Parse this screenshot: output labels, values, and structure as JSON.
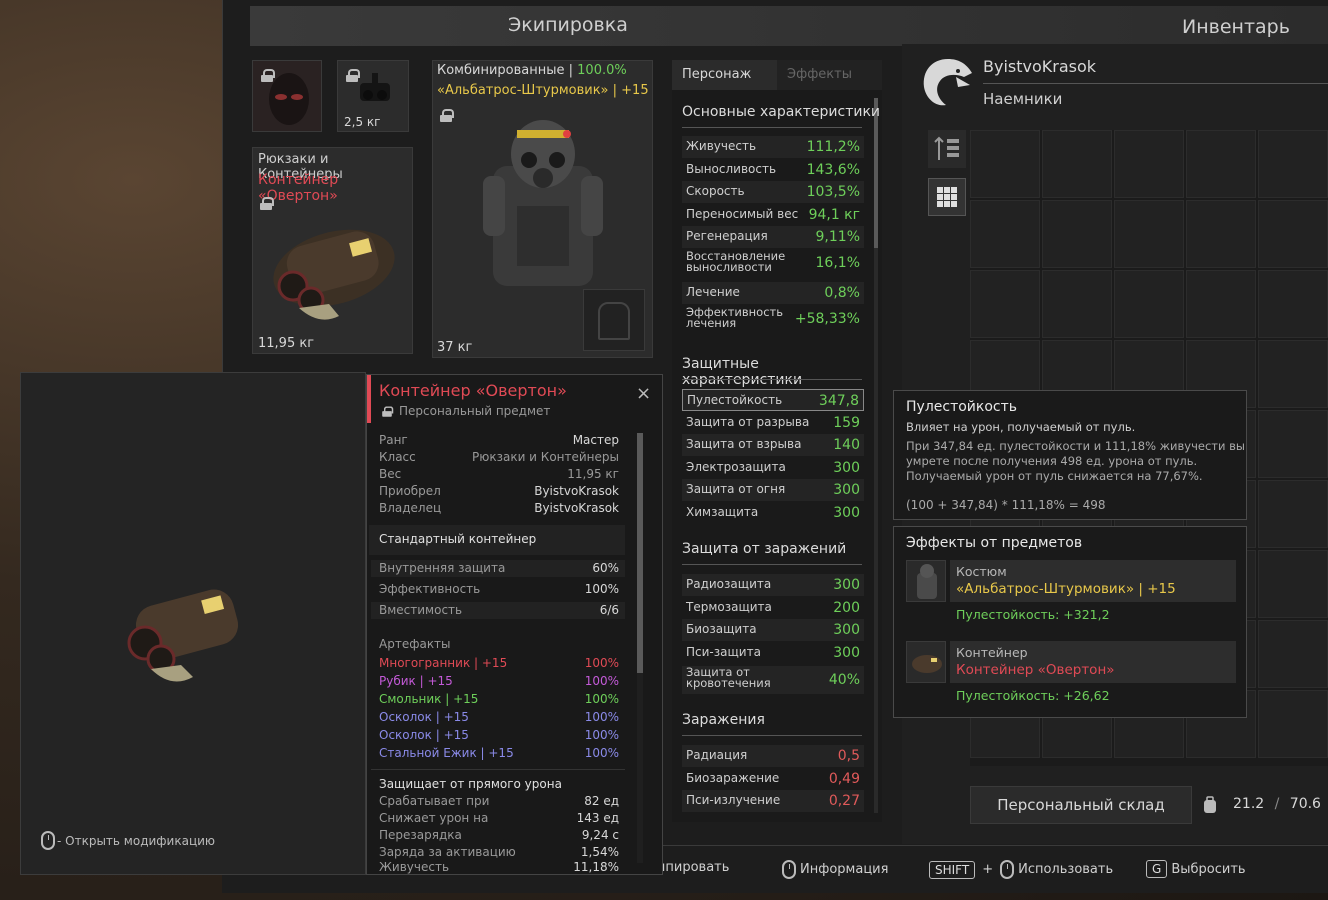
{
  "equipment": {
    "title": "Экипировка",
    "slot_small2_weight": "2,5 кг",
    "backpack_category": "Рюкзаки и Контейнеры",
    "backpack_name": "Контейнер «Овертон»",
    "backpack_weight": "11,95 кг",
    "armor_type": "Комбинированные",
    "armor_type_sep": " | ",
    "armor_percent": "100.0%",
    "armor_name": "«Альбатрос-Штурмовик» | +15",
    "armor_weight": "37 кг"
  },
  "inventory": {
    "title": "Инвентарь",
    "username": "ByistvoKrasok",
    "faction": "Наемники",
    "storage_button": "Персональный склад",
    "weight_current": "21.2",
    "weight_sep": "/",
    "weight_max": "70.6"
  },
  "stats": {
    "tab_character": "Персонаж",
    "tab_effects": "Эффекты",
    "basic_title": "Основные характеристики",
    "basic": [
      {
        "label": "Живучесть",
        "value": "111,2%"
      },
      {
        "label": "Выносливость",
        "value": "143,6%"
      },
      {
        "label": "Скорость",
        "value": "103,5%"
      },
      {
        "label": "Переносимый вес",
        "value": "94,1 кг"
      },
      {
        "label": "Регенерация",
        "value": "9,11%"
      },
      {
        "label": "Восстановление выносливости",
        "value": "16,1%"
      },
      {
        "label": "Лечение",
        "value": "0,8%"
      },
      {
        "label": "Эффективность лечения",
        "value": "+58,33%"
      }
    ],
    "protect_title": "Защитные характеристики",
    "protect": [
      {
        "label": "Пулестойкость",
        "value": "347,8"
      },
      {
        "label": "Защита от разрыва",
        "value": "159"
      },
      {
        "label": "Защита от взрыва",
        "value": "140"
      },
      {
        "label": "Электрозащита",
        "value": "300"
      },
      {
        "label": "Защита от огня",
        "value": "300"
      },
      {
        "label": "Химзащита",
        "value": "300"
      }
    ],
    "infect_title": "Защита от заражений",
    "infect": [
      {
        "label": "Радиозащита",
        "value": "300"
      },
      {
        "label": "Термозащита",
        "value": "200"
      },
      {
        "label": "Биозащита",
        "value": "300"
      },
      {
        "label": "Пси-защита",
        "value": "300"
      },
      {
        "label": "Защита от кровотечения",
        "value": "40%"
      }
    ],
    "contam_title": "Заражения",
    "contam": [
      {
        "label": "Радиация",
        "value": "0,5"
      },
      {
        "label": "Биозаражение",
        "value": "0,49"
      },
      {
        "label": "Пси-излучение",
        "value": "0,27"
      }
    ]
  },
  "tooltip": {
    "title": "Пулестойкость",
    "subtitle": "Влияет на урон, получаемый от пуль.",
    "line1": "При 347,84 ед. пулестойкости и 111,18% живучести вы",
    "line2": "умрете после получения 498 ед. урона от пуль.",
    "line3": "Получаемый урон от пуль снижается на 77,67%.",
    "formula": "(100 + 347,84) * 111,18% = 498"
  },
  "effects": {
    "title": "Эффекты от предметов",
    "items": [
      {
        "type": "Костюм",
        "name": "«Альбатрос-Штурмовик» | +15",
        "bonus": "Пулестойкость: +321,2"
      },
      {
        "type": "Контейнер",
        "name": "Контейнер «Овертон»",
        "bonus": "Пулестойкость: +26,62"
      }
    ]
  },
  "item_info": {
    "name": "Контейнер «Овертон»",
    "personal": "Персональный предмет",
    "props": [
      {
        "k": "Ранг",
        "v": "Мастер"
      },
      {
        "k": "Класс",
        "v": "Рюкзаки и Контейнеры"
      },
      {
        "k": "Вес",
        "v": "11,95 кг"
      },
      {
        "k": "Приобрел",
        "v": "ByistvoKrasok"
      },
      {
        "k": "Владелец",
        "v": "ByistvoKrasok"
      }
    ],
    "desc": "Стандартный контейнер",
    "params": [
      {
        "k": "Внутренняя защита",
        "v": "60%"
      },
      {
        "k": "Эффективность",
        "v": "100%"
      },
      {
        "k": "Вместимость",
        "v": "6/6"
      }
    ],
    "artifacts_title": "Артефакты",
    "artifacts": [
      {
        "name": "Многогранник | +15",
        "pct": "100%",
        "color": "#e04a55"
      },
      {
        "name": "Рубик | +15",
        "pct": "100%",
        "color": "#c45ad8"
      },
      {
        "name": "Смольник | +15",
        "pct": "100%",
        "color": "#6ecf5a"
      },
      {
        "name": "Осколок | +15",
        "pct": "100%",
        "color": "#8a8ae8"
      },
      {
        "name": "Осколок | +15",
        "pct": "100%",
        "color": "#8a8ae8"
      },
      {
        "name": "Стальной Ежик | +15",
        "pct": "100%",
        "color": "#8a8ae8"
      }
    ],
    "direct_title": "Защищает от прямого урона",
    "direct": [
      {
        "k": "Срабатывает при",
        "v": "82 ед"
      },
      {
        "k": "Снижает урон на",
        "v": "143 ед"
      },
      {
        "k": "Перезарядка",
        "v": "9,24 с"
      },
      {
        "k": "Заряда за активацию",
        "v": "1,54%"
      }
    ],
    "last_k": "Живучесть",
    "last_v": "11,18%"
  },
  "preview": {
    "hint": "- Открыть модификацию"
  },
  "hints": {
    "equip": "Экипировать",
    "info": "Информация",
    "shift": "SHIFT",
    "plus": "+",
    "use": "Использовать",
    "g": "G",
    "drop": "Выбросить"
  }
}
